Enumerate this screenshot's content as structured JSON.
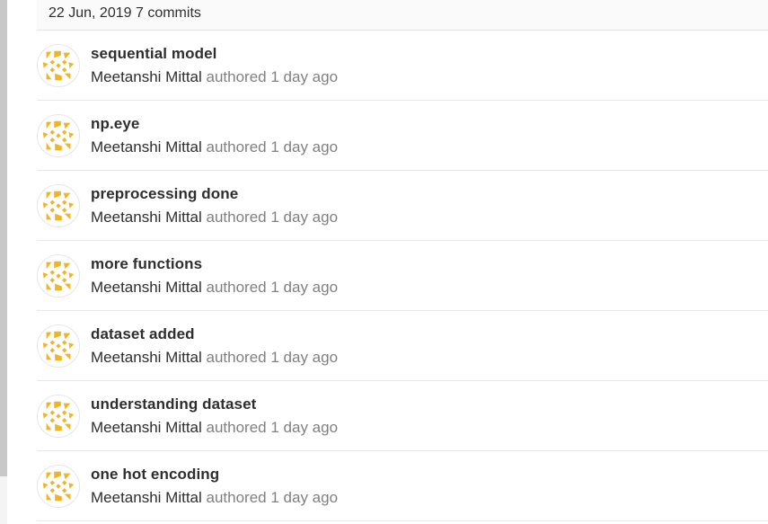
{
  "day_group": {
    "date": "22 Jun, 2019",
    "count": "7 commits"
  },
  "avatar_colors": {
    "accent": "#f0b429",
    "background": "#ffffff",
    "border": "#e6e6e6"
  },
  "commits": [
    {
      "title": "sequential model",
      "author": "Meetanshi Mittal",
      "verb": "authored",
      "time": "1 day ago"
    },
    {
      "title": "np.eye",
      "author": "Meetanshi Mittal",
      "verb": "authored",
      "time": "1 day ago"
    },
    {
      "title": "preprocessing done",
      "author": "Meetanshi Mittal",
      "verb": "authored",
      "time": "1 day ago"
    },
    {
      "title": "more functions",
      "author": "Meetanshi Mittal",
      "verb": "authored",
      "time": "1 day ago"
    },
    {
      "title": "dataset added",
      "author": "Meetanshi Mittal",
      "verb": "authored",
      "time": "1 day ago"
    },
    {
      "title": "understanding dataset",
      "author": "Meetanshi Mittal",
      "verb": "authored",
      "time": "1 day ago"
    },
    {
      "title": "one hot encoding",
      "author": "Meetanshi Mittal",
      "verb": "authored",
      "time": "1 day ago"
    }
  ]
}
